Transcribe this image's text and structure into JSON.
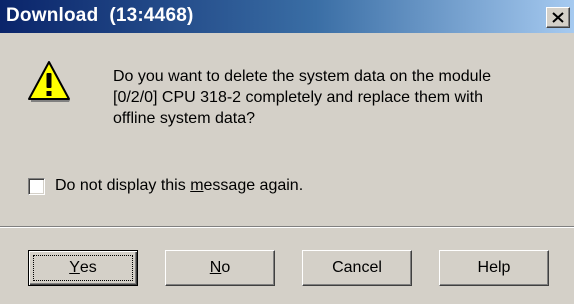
{
  "window": {
    "title": "Download  (13:4468)",
    "close_glyph": "x-close-icon"
  },
  "message": {
    "icon": "warning-icon",
    "text": "Do you want to delete the system data on the module\n[0/2/0] CPU 318-2 completely and replace them with\noffline system data?"
  },
  "checkbox": {
    "label_pre": "Do not display this ",
    "label_mnemonic": "m",
    "label_post": "essage again.",
    "checked": false
  },
  "buttons": {
    "yes": {
      "mnemonic": "Y",
      "rest": "es"
    },
    "no": {
      "mnemonic": "N",
      "rest": "o"
    },
    "cancel": {
      "label": "Cancel"
    },
    "help": {
      "label": "Help"
    }
  },
  "colors": {
    "titlebar_start": "#0a246a",
    "titlebar_end": "#a6caf0",
    "face": "#d4d0c8",
    "warning_yellow": "#ffff00"
  }
}
